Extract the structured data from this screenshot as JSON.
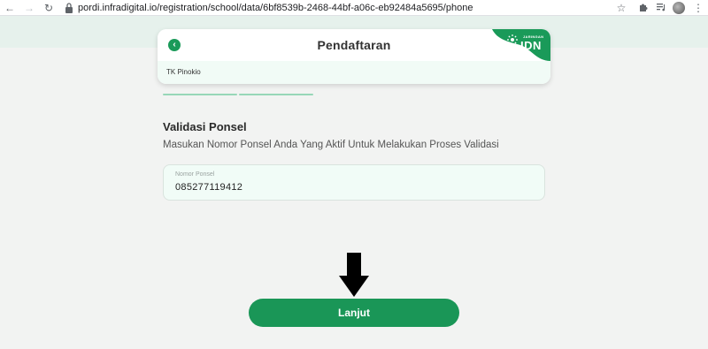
{
  "browser": {
    "url": "pordi.infradigital.io/registration/school/data/6bf8539b-2468-44bf-a06c-eb92484a5695/phone",
    "icons": [
      "back-icon",
      "forward-icon",
      "reload-icon",
      "lock-icon",
      "star-icon",
      "puzzle-icon",
      "media-icon",
      "profile-avatar",
      "menu-icon"
    ]
  },
  "header": {
    "title": "Pendaftaran",
    "school_name": "TK Pinokio",
    "logo_top": "JARINGAN",
    "logo_main": "IDN",
    "brand_color": "#1a9a59"
  },
  "progress": {
    "steps_shown": 2
  },
  "content": {
    "section_title": "Validasi Ponsel",
    "section_description": "Masukan Nomor Ponsel Anda Yang Aktif Untuk Melakukan Proses Validasi",
    "phone_field_label": "Nomor Ponsel",
    "phone_value": "085277119412"
  },
  "actions": {
    "next_label": "Lanjut"
  }
}
